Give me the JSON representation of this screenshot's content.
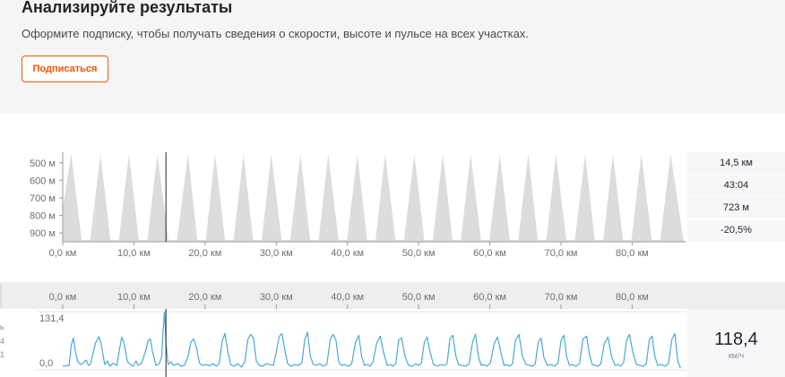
{
  "upsell": {
    "title": "Анализируйте результаты",
    "text": "Оформите подписку, чтобы получать сведения о скорости, высоте и пульсе на всех участках.",
    "button_label": "Подписаться",
    "accent_color": "#fc5200"
  },
  "elevation_chart": {
    "y_ticks": [
      "900 м",
      "800 м",
      "700 м",
      "600 м",
      "500 м"
    ],
    "x_ticks": [
      "0,0 км",
      "10,0 км",
      "20,0 км",
      "30,0 км",
      "40,0 км",
      "50,0 км",
      "60,0 км",
      "70,0 км",
      "80,0 км"
    ],
    "fill_color": "#dcdcdc"
  },
  "stats": {
    "distance": "14,5 км",
    "time": "43:04",
    "elevation": "723 м",
    "grade": "-20,5%"
  },
  "axis_strip": {
    "x_ticks": [
      "0,0 км",
      "10,0 км",
      "20,0 км",
      "30,0 км",
      "40,0 км",
      "50,0 км",
      "60,0 км",
      "70,0 км",
      "80,0 км"
    ]
  },
  "speed_chart": {
    "y_max_label": "131,4",
    "y_min_label": "0,0",
    "line_color": "#4aa8d8",
    "current_value": "118,4",
    "unit": "км/ч",
    "cut_labels": [
      "ь",
      "4",
      "1"
    ]
  },
  "chart_data": [
    {
      "type": "area",
      "xlabel": "",
      "ylabel": "",
      "x_unit": "км",
      "y_unit": "м",
      "xlim": [
        0,
        87.5
      ],
      "ylim": [
        450,
        960
      ],
      "x_ticks": [
        0,
        10,
        20,
        30,
        40,
        50,
        60,
        70,
        80
      ],
      "y_ticks": [
        500,
        600,
        700,
        800,
        900
      ],
      "grid": false,
      "peaks_km": [
        1.2,
        5.3,
        9.3,
        13.3,
        17.6,
        21.4,
        25.4,
        29.3,
        33.4,
        37.3,
        41.4,
        45.3,
        49.4,
        53.4,
        57.3,
        61.4,
        65.4,
        69.3,
        73.4,
        77.3,
        81.3,
        85.4
      ],
      "peak_elevation_m": 950,
      "valley_elevation_m": 460,
      "cursor_km": 14.5
    },
    {
      "type": "line",
      "xlabel": "",
      "ylabel": "",
      "x_unit": "км",
      "y_unit": "км/ч",
      "xlim": [
        0,
        87.5
      ],
      "ylim": [
        0,
        131.4
      ],
      "grid": false,
      "legend": "none",
      "x": [
        0,
        0.9,
        1.2,
        1.5,
        1.8,
        2.1,
        2.6,
        3.3,
        3.6,
        3.9,
        4.6,
        5.1,
        5.4,
        5.9,
        6.3,
        6.6,
        7.1,
        7.6,
        8.0,
        8.3,
        8.6,
        9.1,
        9.5,
        9.9,
        10.3,
        10.6,
        11.1,
        11.6,
        12.0,
        12.3,
        12.6,
        13.1,
        13.6,
        13.9,
        14.1,
        14.3,
        14.5,
        14.8,
        15.2,
        15.6,
        16.2,
        16.6,
        17.1,
        17.6,
        18.0,
        18.4,
        18.8,
        19.2,
        19.6,
        20.1,
        20.6,
        21.1,
        21.6,
        22.0,
        22.4,
        22.8,
        23.2,
        23.6,
        24.1,
        24.6,
        25.1,
        25.6,
        26.0,
        26.4,
        26.8,
        27.2,
        27.6,
        28.1,
        28.6,
        29.1,
        29.6,
        30.0,
        30.4,
        30.8,
        31.2,
        31.6,
        32.1,
        32.6,
        33.1,
        33.6,
        34.0,
        34.4,
        34.8,
        35.2,
        35.6,
        36.1,
        36.6,
        37.1,
        37.6,
        38.0,
        38.4,
        38.8,
        39.2,
        39.6,
        40.1,
        40.6,
        41.1,
        41.6,
        42.0,
        42.4,
        42.8,
        43.2,
        43.6,
        44.1,
        44.6,
        45.1,
        45.6,
        46.0,
        46.4,
        46.8,
        47.2,
        47.6,
        48.1,
        48.6,
        49.1,
        49.6,
        50.0,
        50.4,
        50.8,
        51.2,
        51.6,
        52.1,
        52.6,
        53.1,
        53.6,
        54.0,
        54.4,
        54.8,
        55.2,
        55.6,
        56.1,
        56.6,
        57.1,
        57.6,
        58.0,
        58.4,
        58.8,
        59.2,
        59.6,
        60.1,
        60.6,
        61.1,
        61.6,
        62.0,
        62.4,
        62.8,
        63.2,
        63.6,
        64.1,
        64.6,
        65.1,
        65.6,
        66.0,
        66.4,
        66.8,
        67.2,
        67.6,
        68.1,
        68.6,
        69.1,
        69.6,
        70.0,
        70.4,
        70.8,
        71.2,
        71.6,
        72.1,
        72.6,
        73.1,
        73.6,
        74.0,
        74.4,
        74.8,
        75.2,
        75.6,
        76.1,
        76.6,
        77.1,
        77.6,
        78.0,
        78.4,
        78.8,
        79.2,
        79.6,
        80.1,
        80.6,
        81.1,
        81.6,
        82.0,
        82.4,
        82.8,
        83.2,
        83.6,
        84.1,
        84.6,
        85.1,
        85.6,
        86.0,
        86.4,
        86.8,
        87.1,
        87.5
      ],
      "y": [
        8,
        10,
        55,
        72,
        40,
        18,
        12,
        22,
        10,
        14,
        60,
        75,
        58,
        12,
        20,
        8,
        15,
        10,
        48,
        74,
        60,
        18,
        12,
        8,
        20,
        10,
        16,
        40,
        66,
        70,
        42,
        10,
        15,
        30,
        88,
        131,
        60,
        12,
        18,
        10,
        14,
        8,
        10,
        30,
        62,
        70,
        50,
        16,
        10,
        12,
        9,
        14,
        8,
        15,
        65,
        82,
        40,
        12,
        8,
        14,
        6,
        18,
        68,
        80,
        72,
        20,
        10,
        8,
        14,
        12,
        10,
        40,
        75,
        82,
        45,
        14,
        8,
        12,
        10,
        16,
        68,
        85,
        30,
        12,
        10,
        14,
        8,
        12,
        70,
        80,
        66,
        16,
        10,
        12,
        8,
        14,
        60,
        78,
        30,
        10,
        12,
        8,
        18,
        60,
        76,
        38,
        10,
        12,
        8,
        14,
        68,
        72,
        30,
        10,
        8,
        14,
        10,
        16,
        62,
        74,
        40,
        12,
        8,
        12,
        10,
        14,
        70,
        78,
        34,
        12,
        10,
        8,
        14,
        64,
        80,
        30,
        10,
        12,
        8,
        16,
        58,
        74,
        36,
        10,
        12,
        8,
        14,
        66,
        80,
        30,
        12,
        10,
        8,
        14,
        62,
        72,
        28,
        10,
        12,
        8,
        16,
        66,
        78,
        30,
        10,
        12,
        8,
        14,
        70,
        76,
        34,
        12,
        10,
        8,
        14,
        60,
        74,
        30,
        10,
        12,
        8,
        16,
        66,
        80,
        40,
        12,
        10,
        8,
        14,
        68,
        76,
        30,
        10,
        12,
        8,
        14,
        70,
        82,
        20,
        4
      ],
      "cursor_km": 14.5
    }
  ]
}
